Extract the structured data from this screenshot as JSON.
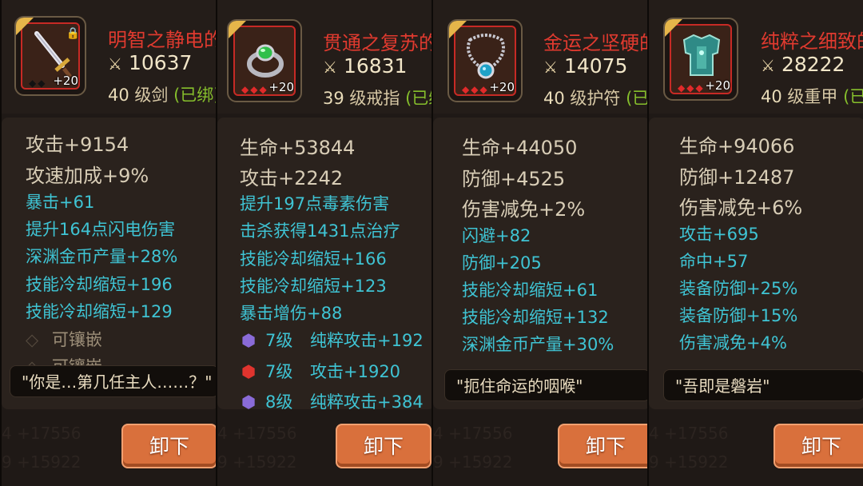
{
  "cards": [
    {
      "name": "明智之静电的",
      "power": "10637",
      "level": "40",
      "level_unit": "级剑",
      "bound": "(已绑)",
      "plus": "+20",
      "icon": "sword-icon",
      "stats_big": [
        "攻击+9154",
        "攻速加成+9%"
      ],
      "stats_small": [
        "暴击+61",
        "提升164点闪电伤害",
        "深渊金币产量+28%",
        "技能冷却缩短+196",
        "技能冷却缩短+129"
      ],
      "sockets": [
        "可镶嵌",
        "可镶嵌"
      ],
      "quote": "\"你是…第几任主人……？\"",
      "button": "卸下",
      "ghost": [
        "4 +17556",
        "9 +15922"
      ]
    },
    {
      "name": "贯通之复苏的",
      "power": "16831",
      "level": "39",
      "level_unit": "级戒指",
      "bound": "(已绑",
      "plus": "+20",
      "icon": "ring-icon",
      "stats_big": [
        "生命+53844",
        "攻击+2242"
      ],
      "stats_small": [
        "提升197点毒素伤害",
        "击杀获得1431点治疗",
        "技能冷却缩短+166",
        "技能冷却缩短+123",
        "暴击增伤+88"
      ],
      "gems": [
        {
          "level": "7级",
          "text": "纯粹攻击+192",
          "color": "#8a6bd8"
        },
        {
          "level": "7级",
          "text": "攻击+1920",
          "color": "#e0342e"
        },
        {
          "level": "8级",
          "text": "纯粹攻击+384",
          "color": "#8a6bd8"
        }
      ],
      "button": "卸下",
      "ghost": [
        "4 +17556",
        "9 +15922"
      ]
    },
    {
      "name": "金运之坚硬的",
      "power": "14075",
      "level": "40",
      "level_unit": "级护符",
      "bound": "(已",
      "plus": "+20",
      "icon": "amulet-icon",
      "stats_big": [
        "生命+44050",
        "防御+4525",
        "伤害减免+2%"
      ],
      "stats_small": [
        "闪避+82",
        "防御+205",
        "技能冷却缩短+61",
        "技能冷却缩短+132",
        "深渊金币产量+30%"
      ],
      "quote": "\"扼住命运的咽喉\"",
      "button": "卸下",
      "ghost": [
        "4 +17556",
        "9 +15922"
      ]
    },
    {
      "name": "纯粹之细致的",
      "power": "28222",
      "level": "40",
      "level_unit": "级重甲",
      "bound": "(已",
      "plus": "+20",
      "icon": "armor-icon",
      "stats_big": [
        "生命+94066",
        "防御+12487",
        "伤害减免+6%"
      ],
      "stats_small": [
        "攻击+695",
        "命中+57",
        "装备防御+25%",
        "装备防御+15%",
        "伤害减免+4%"
      ],
      "quote": "\"吾即是磐岩\"",
      "button": "卸下",
      "ghost": [
        "4 +17556",
        "9 +15922"
      ]
    }
  ]
}
